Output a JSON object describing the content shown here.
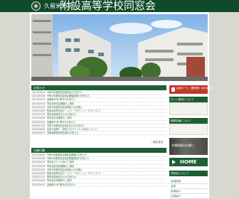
{
  "header": {
    "site_name_small": "久留米大学",
    "site_name_main": "附設高等学校同窓会"
  },
  "news": {
    "title": "お知らせ",
    "items": [
      {
        "date": "2021/06/10",
        "text": "令和3年度関東支部総会のお知らせ"
      },
      {
        "date": "2021/05/28",
        "text": "令和3年度同窓会総会開催延期のお知らせ"
      },
      {
        "date": "2021/04/15",
        "text": "会報第36号 発刊のお知らせ"
      },
      {
        "date": "2021/03/20",
        "text": "同窓会役員会開催のご報告"
      },
      {
        "date": "2021/02/10",
        "text": "令和3年度同窓会会費納入のお願い"
      },
      {
        "date": "2020/12/01",
        "text": "附設高校同窓会ホームページのリニューアルについて"
      },
      {
        "date": "2020/11/15",
        "text": "関西支部総会中止のお知らせ"
      },
      {
        "date": "2020/10/08",
        "text": "同窓会名簿更新のご案内"
      },
      {
        "date": "2020/09/02",
        "text": "会報第35号 発刊のお知らせ"
      },
      {
        "date": "2020/07/20",
        "text": "令和2年度同窓会総会中止のお知らせ"
      },
      {
        "date": "2020/06/05",
        "text": "会員の皆様へ（新型コロナウイルス対応について）"
      },
      {
        "date": "2020/04/01",
        "text": "事務局開設時間変更のお知らせ"
      }
    ],
    "more": "一覧を見る"
  },
  "events": {
    "title": "主催行事",
    "items": [
      {
        "date": "2021/06/10",
        "text": "令和3年度関東支部総会開催のお知らせ"
      },
      {
        "date": "2021/05/28",
        "text": "令和3年度同窓会総会開催延期のお知らせ"
      },
      {
        "date": "2021/04/15",
        "text": "同窓会ゴルフ大会のご案内"
      },
      {
        "date": "2021/03/20",
        "text": "同窓会役員会開催のご報告"
      },
      {
        "date": "2021/02/10",
        "text": "令和3年度同窓会会費納入のお願い"
      },
      {
        "date": "2020/12/01",
        "text": "附設高校同窓会ホームページのリニューアルについて"
      },
      {
        "date": "2020/11/15",
        "text": "関西支部総会中止のお知らせ"
      },
      {
        "date": "2020/10/08",
        "text": "同窓会名簿更新のご案内"
      },
      {
        "date": "2020/09/02",
        "text": "会報第35号 発刊のお知らせ"
      }
    ]
  },
  "sidebar": {
    "login_button": "会員ページ（要登録）Web会報",
    "section1_title": "ネット販売について",
    "section2_title": "関連会議について",
    "photo_caption": "名簿掲載のお願い",
    "home_label": "HOME",
    "section3_title": "同窓会について",
    "links": [
      "会長挨拶",
      "会則",
      "役員紹介",
      "支部紹介"
    ]
  },
  "colors": {
    "header_green": "#0f4a2a",
    "section_green": "#1e5e35",
    "alert_red": "#c0392b",
    "link_green": "#2e6b3e"
  }
}
